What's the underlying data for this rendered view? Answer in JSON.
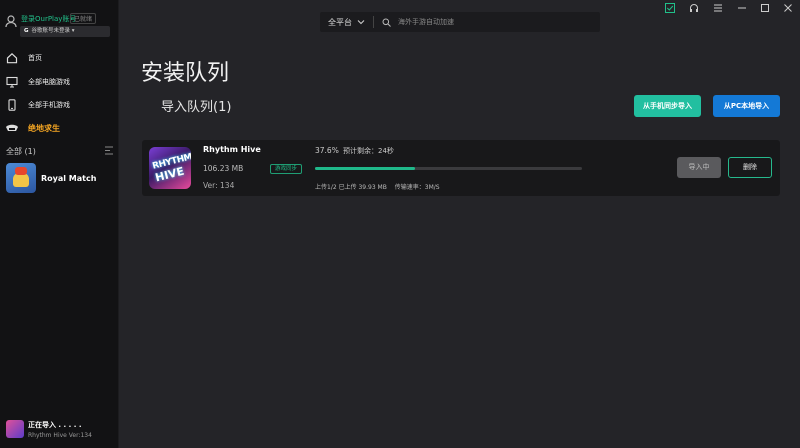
{
  "colors": {
    "accent_green": "#22bfa0",
    "accent_blue": "#1479d6",
    "active_orange": "#f5a623",
    "progress": "#1fb88a"
  },
  "account": {
    "login_label": "登录OurPlay账号",
    "status_tag": "已就绪",
    "google_label": "谷歌账号未登录"
  },
  "sidebar": {
    "items": [
      {
        "label": "首页",
        "icon": "home-icon"
      },
      {
        "label": "全部电脑游戏",
        "icon": "monitor-icon"
      },
      {
        "label": "全部手机游戏",
        "icon": "phone-icon"
      },
      {
        "label": "绝地求生",
        "icon": "pubg-icon"
      }
    ],
    "all_label": "全部 (1)",
    "games": [
      {
        "name": "Royal Match"
      }
    ],
    "importing": {
      "title": "正在导入 . . . . .",
      "subtitle": "Rhythm Hive Ver:134"
    }
  },
  "search": {
    "platform": "全平台",
    "placeholder": "海外手游自动加速"
  },
  "page": {
    "title": "安装队列",
    "section_title": "导入队列(1)",
    "btn_phone_sync": "从手机同步导入",
    "btn_pc_import": "从PC本地导入"
  },
  "queue": [
    {
      "name": "Rhythm Hive",
      "icon_text_1": "RHYTHM",
      "icon_text_2": "HIVE",
      "size": "106.23 MB",
      "sync_badge": "游戏同步",
      "version": "Ver: 134",
      "percent": "37.6%",
      "progress": 0.376,
      "eta": "预计剩余：24秒",
      "uploaded": "上传1/2 已上传 39.93 MB",
      "speed": "传输速率：3M/S",
      "import_btn": "导入中",
      "delete_btn": "删除"
    }
  ]
}
